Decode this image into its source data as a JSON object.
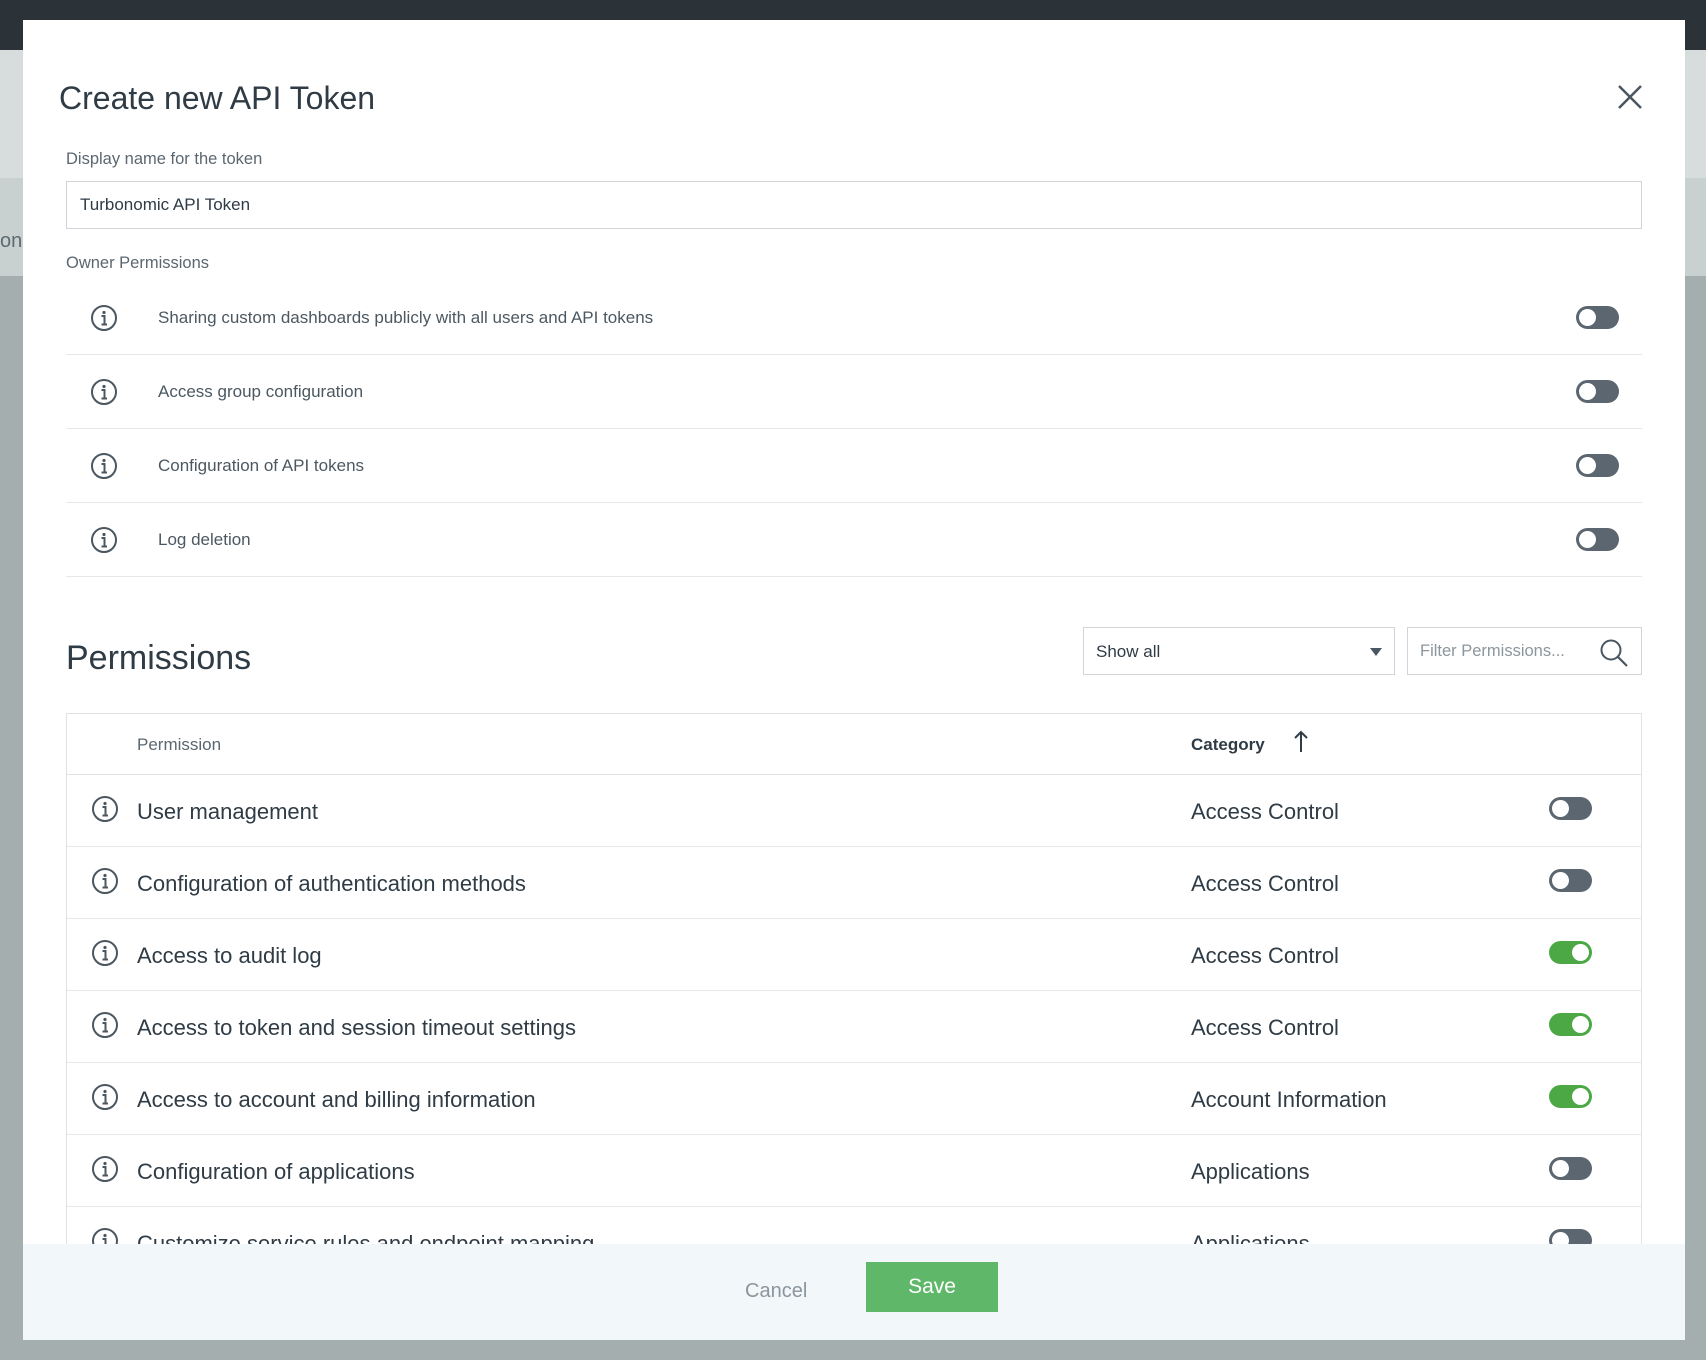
{
  "background": {
    "partial_text": "on"
  },
  "modal": {
    "title": "Create new API Token",
    "display_name_label": "Display name for the token",
    "display_name_value": "Turbonomic API Token",
    "owner_permissions_label": "Owner Permissions",
    "owner_permissions": [
      {
        "label": "Sharing custom dashboards publicly with all users and API tokens",
        "enabled": false
      },
      {
        "label": "Access group configuration",
        "enabled": false
      },
      {
        "label": "Configuration of API tokens",
        "enabled": false
      },
      {
        "label": "Log deletion",
        "enabled": false
      }
    ],
    "permissions_title": "Permissions",
    "filter_select_value": "Show all",
    "filter_placeholder": "Filter Permissions...",
    "table": {
      "columns": [
        "Permission",
        "Category"
      ],
      "sort_column": "Category",
      "sort_direction": "ascending",
      "rows": [
        {
          "permission": "User management",
          "category": "Access Control",
          "enabled": false
        },
        {
          "permission": "Configuration of authentication methods",
          "category": "Access Control",
          "enabled": false
        },
        {
          "permission": "Access to audit log",
          "category": "Access Control",
          "enabled": true
        },
        {
          "permission": "Access to token and session timeout settings",
          "category": "Access Control",
          "enabled": true
        },
        {
          "permission": "Access to account and billing information",
          "category": "Account Information",
          "enabled": true
        },
        {
          "permission": "Configuration of applications",
          "category": "Applications",
          "enabled": false
        },
        {
          "permission": "Customize service rules and endpoint mapping",
          "category": "Applications",
          "enabled": false
        }
      ]
    },
    "footer": {
      "cancel_label": "Cancel",
      "save_label": "Save"
    }
  },
  "colors": {
    "toggle_on": "#4ba845",
    "toggle_off": "#5b6670",
    "save_button": "#5fb86a",
    "top_bar": "#2b3238"
  }
}
